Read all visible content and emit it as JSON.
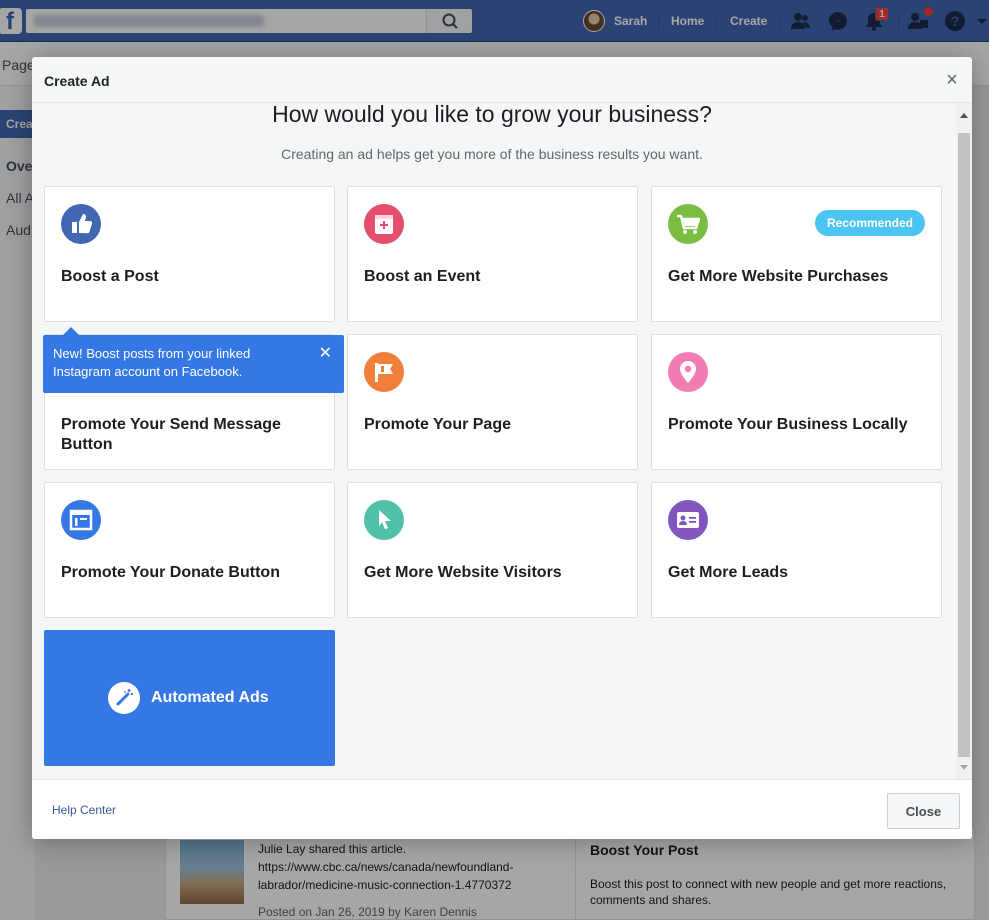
{
  "topbar": {
    "logo": "f",
    "user_name": "Sarah",
    "home": "Home",
    "create": "Create",
    "notification_count": "1"
  },
  "background": {
    "subnav_fragment": "Page",
    "side_create": "Crea",
    "side_items": [
      "Ove",
      "All A",
      "Aud"
    ],
    "post_line1": "Julie Lay shared this article.",
    "post_line2": "https://www.cbc.ca/news/canada/newfoundland-",
    "post_line3": "labrador/medicine-music-connection-1.4770372",
    "post_line4": "Posted on Jan 26, 2019 by Karen Dennis",
    "boost_title": "Boost Your Post",
    "boost_desc1": "Boost this post to connect with new people and get more reactions,",
    "boost_desc2": "comments and shares."
  },
  "modal": {
    "title": "Create Ad",
    "heading": "How would you like to grow your business?",
    "subheading": "Creating an ad helps get you more of the business results you want.",
    "cards": [
      {
        "label": "Boost a Post",
        "icon": "thumbs-up-icon",
        "color": "#4267b2"
      },
      {
        "label": "Boost an Event",
        "icon": "calendar-icon",
        "color": "#e44d6b"
      },
      {
        "label": "Get More Website Purchases",
        "icon": "shopping-cart-icon",
        "color": "#7bbd3f",
        "badge": "Recommended"
      },
      {
        "label": "Promote Your Send Message Button",
        "icon": "messenger-icon",
        "color": "#0084ff"
      },
      {
        "label": "Promote Your Page",
        "icon": "flag-icon",
        "color": "#f07f3a"
      },
      {
        "label": "Promote Your Business Locally",
        "icon": "location-pin-icon",
        "color": "#ef7cb3"
      },
      {
        "label": "Promote Your Donate Button",
        "icon": "donate-window-icon",
        "color": "#3578e5"
      },
      {
        "label": "Get More Website Visitors",
        "icon": "cursor-icon",
        "color": "#4fc1a6"
      },
      {
        "label": "Get More Leads",
        "icon": "contact-card-icon",
        "color": "#8055c0"
      }
    ],
    "automated": "Automated Ads",
    "tooltip": "New! Boost posts from your linked Instagram account on Facebook.",
    "footer_help": "Help Center",
    "footer_close": "Close"
  }
}
